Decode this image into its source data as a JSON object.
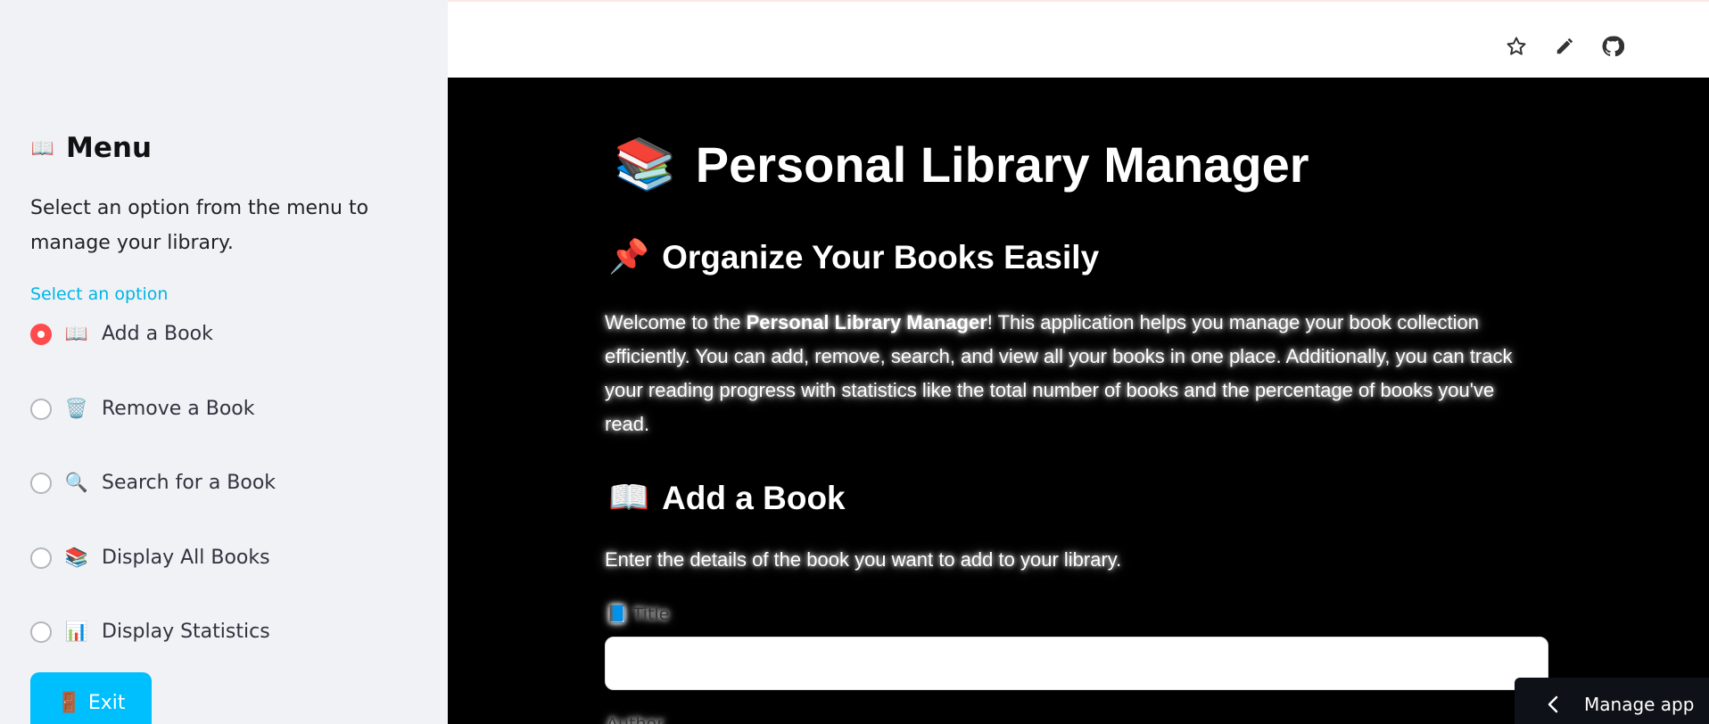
{
  "sidebar": {
    "header_icon": "📖",
    "header": "Menu",
    "description": "Select an option from the menu to manage your library.",
    "select_label": "Select an option",
    "options": [
      {
        "icon": "📖",
        "label": "Add a Book",
        "selected": true
      },
      {
        "icon": "🗑️",
        "label": "Remove a Book",
        "selected": false
      },
      {
        "icon": "🔍",
        "label": "Search for a Book",
        "selected": false
      },
      {
        "icon": "📚",
        "label": "Display All Books",
        "selected": false
      },
      {
        "icon": "📊",
        "label": "Display Statistics",
        "selected": false
      }
    ],
    "exit_icon": "🚪",
    "exit_label": "Exit"
  },
  "topbar": {
    "icons": [
      "star-icon",
      "pencil-icon",
      "github-icon"
    ]
  },
  "main": {
    "title_icon": "📚",
    "title": "Personal Library Manager",
    "subtitle_icon": "📌",
    "subtitle": "Organize Your Books Easily",
    "intro_prefix": "Welcome to the ",
    "intro_bold": "Personal Library Manager",
    "intro_rest": "! This application helps you manage your book collection efficiently. You can add, remove, search, and view all your books in one place. Additionally, you can track your reading progress with statistics like the total number of books and the percentage of books you've read.",
    "section_icon": "📖",
    "section_title": "Add a Book",
    "section_desc": "Enter the details of the book you want to add to your library.",
    "title_field_icon": "📘",
    "title_field_label": "Title",
    "title_field_value": "",
    "next_field_label": "Author"
  },
  "manage_app": {
    "label": "Manage app"
  },
  "colors": {
    "sidebar_bg": "#f0f2f6",
    "accent_blue": "#00bfff",
    "radio_selected": "#ff4b4b",
    "main_bg": "#000000"
  }
}
